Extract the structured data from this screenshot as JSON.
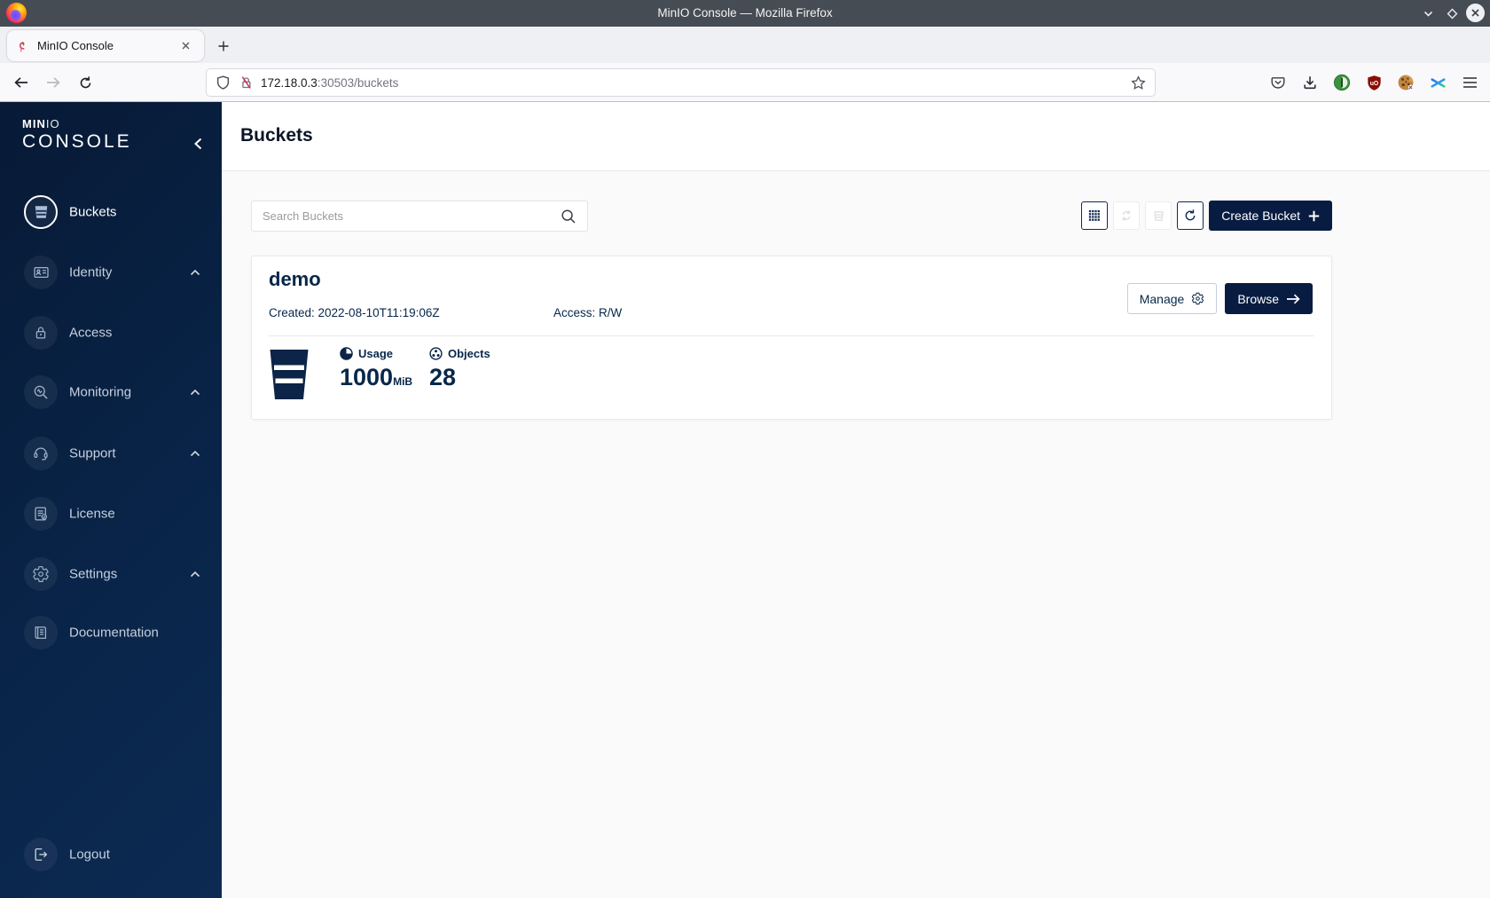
{
  "window": {
    "title": "MinIO Console — Mozilla Firefox"
  },
  "tab": {
    "title": "MinIO Console"
  },
  "urlbar": {
    "host": "172.18.0.3",
    "rest": ":30503/buckets"
  },
  "sidebar": {
    "logo": {
      "min": "MIN",
      "io": "IO",
      "console": "CONSOLE"
    },
    "items": [
      {
        "label": "Buckets",
        "active": true
      },
      {
        "label": "Identity",
        "expandable": true
      },
      {
        "label": "Access"
      },
      {
        "label": "Monitoring",
        "expandable": true
      },
      {
        "label": "Support",
        "expandable": true
      },
      {
        "label": "License"
      },
      {
        "label": "Settings",
        "expandable": true
      },
      {
        "label": "Documentation"
      }
    ],
    "logout": "Logout"
  },
  "page": {
    "title": "Buckets"
  },
  "controls": {
    "search_placeholder": "Search Buckets",
    "create_button": "Create Bucket"
  },
  "bucket": {
    "name": "demo",
    "created": "Created: 2022-08-10T11:19:06Z",
    "access": "Access: R/W",
    "usage_label": "Usage",
    "usage_value": "1000",
    "usage_unit": "MiB",
    "objects_label": "Objects",
    "objects_value": "28",
    "manage": "Manage",
    "browse": "Browse"
  },
  "icons": {
    "ublock_text": "uO",
    "firefox-logo": "flame-circle",
    "flamingo-favicon": "flamingo",
    "tab-close": "✕",
    "new-tab": "+",
    "minimize": "⌄",
    "maximize": "◇",
    "close-window": "⊗",
    "back": "←",
    "forward": "→",
    "reload": "⟳",
    "shield": "shield-outline",
    "insecure-lock": "lock-red-slash",
    "bookmark-star": "☆",
    "pocket": "pocket",
    "download": "↓",
    "extension-green": "green-circle",
    "extension-cookie": "cookie",
    "extension-asterisk": "✳",
    "menu": "≡",
    "sidebar-collapse": "‹",
    "caret-up": "⌃",
    "search": "magnifier",
    "grid-view": "dot-grid",
    "sync": "circular-arrows",
    "delete-bucket": "bucket",
    "refresh": "↻",
    "plus": "+",
    "gear": "⚙",
    "arrow-right": "→",
    "usage": "pie-three-quarter",
    "objects": "circle-three-dots"
  },
  "colors": {
    "brand_navy": "#081C42",
    "text_navy": "#07274A",
    "titlebar": "#464C53",
    "sidebar_start": "#071A36",
    "sidebar_end": "#0C2A52",
    "content_bg": "#FAFAFA",
    "disabled": "#DEDEDE",
    "insecure_red": "#E22850"
  }
}
